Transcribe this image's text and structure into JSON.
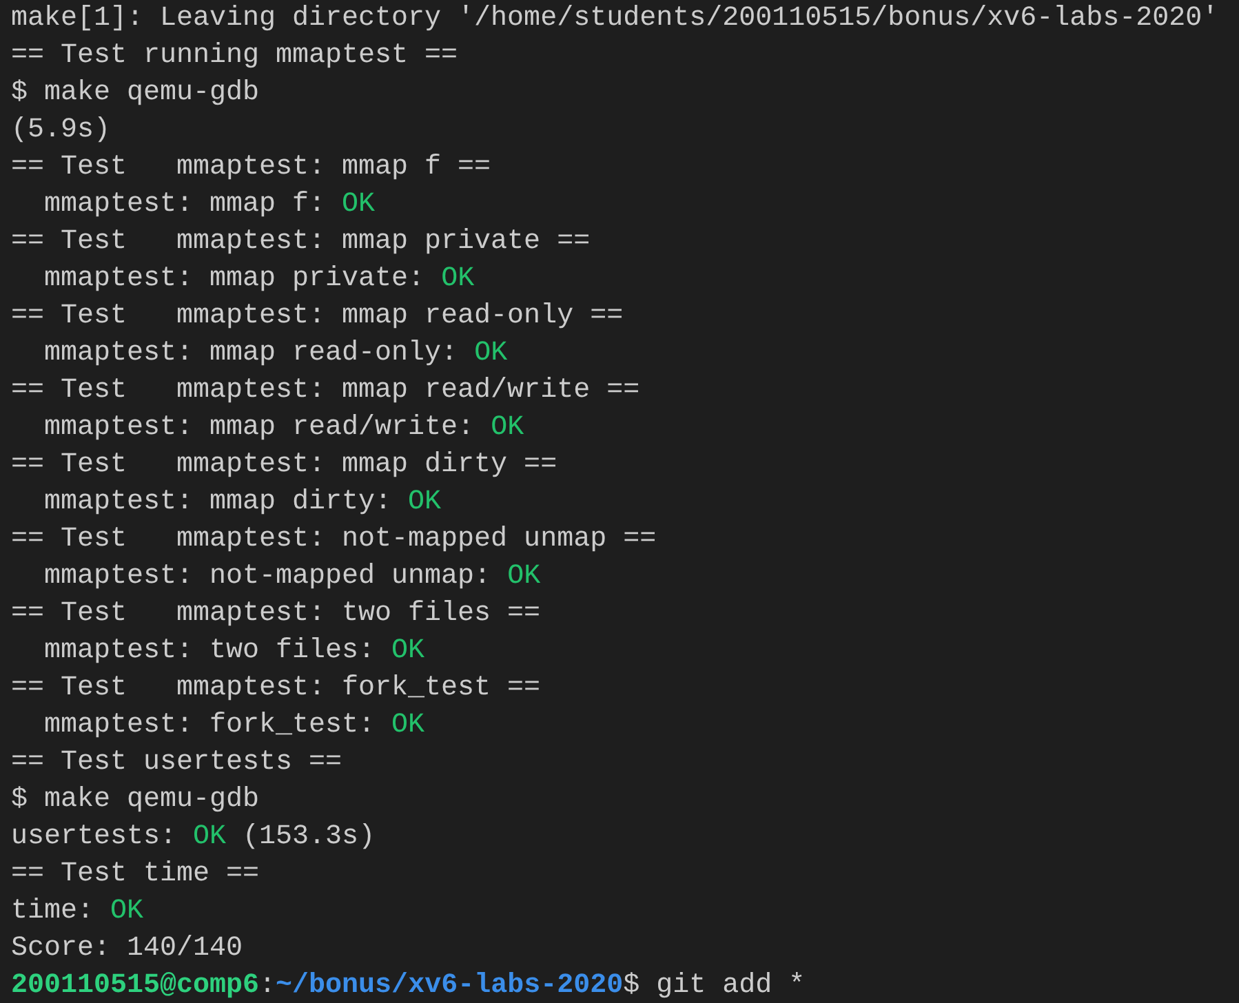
{
  "terminal": {
    "lines": [
      {
        "segments": [
          {
            "kind": "output",
            "text": "make[1]: Leaving directory '/home/students/200110515/bonus/xv6-labs-2020'"
          }
        ]
      },
      {
        "segments": [
          {
            "kind": "output",
            "text": "== Test running mmaptest =="
          }
        ]
      },
      {
        "segments": [
          {
            "kind": "output",
            "text": "$ make qemu-gdb"
          }
        ]
      },
      {
        "segments": [
          {
            "kind": "output",
            "text": "(5.9s)"
          }
        ]
      },
      {
        "segments": [
          {
            "kind": "output",
            "text": "== Test   mmaptest: mmap f =="
          }
        ]
      },
      {
        "segments": [
          {
            "kind": "output",
            "text": "  mmaptest: mmap f: "
          },
          {
            "kind": "ok",
            "text": "OK"
          }
        ]
      },
      {
        "segments": [
          {
            "kind": "output",
            "text": "== Test   mmaptest: mmap private =="
          }
        ]
      },
      {
        "segments": [
          {
            "kind": "output",
            "text": "  mmaptest: mmap private: "
          },
          {
            "kind": "ok",
            "text": "OK"
          }
        ]
      },
      {
        "segments": [
          {
            "kind": "output",
            "text": "== Test   mmaptest: mmap read-only =="
          }
        ]
      },
      {
        "segments": [
          {
            "kind": "output",
            "text": "  mmaptest: mmap read-only: "
          },
          {
            "kind": "ok",
            "text": "OK"
          }
        ]
      },
      {
        "segments": [
          {
            "kind": "output",
            "text": "== Test   mmaptest: mmap read/write =="
          }
        ]
      },
      {
        "segments": [
          {
            "kind": "output",
            "text": "  mmaptest: mmap read/write: "
          },
          {
            "kind": "ok",
            "text": "OK"
          }
        ]
      },
      {
        "segments": [
          {
            "kind": "output",
            "text": "== Test   mmaptest: mmap dirty =="
          }
        ]
      },
      {
        "segments": [
          {
            "kind": "output",
            "text": "  mmaptest: mmap dirty: "
          },
          {
            "kind": "ok",
            "text": "OK"
          }
        ]
      },
      {
        "segments": [
          {
            "kind": "output",
            "text": "== Test   mmaptest: not-mapped unmap =="
          }
        ]
      },
      {
        "segments": [
          {
            "kind": "output",
            "text": "  mmaptest: not-mapped unmap: "
          },
          {
            "kind": "ok",
            "text": "OK"
          }
        ]
      },
      {
        "segments": [
          {
            "kind": "output",
            "text": "== Test   mmaptest: two files =="
          }
        ]
      },
      {
        "segments": [
          {
            "kind": "output",
            "text": "  mmaptest: two files: "
          },
          {
            "kind": "ok",
            "text": "OK"
          }
        ]
      },
      {
        "segments": [
          {
            "kind": "output",
            "text": "== Test   mmaptest: fork_test =="
          }
        ]
      },
      {
        "segments": [
          {
            "kind": "output",
            "text": "  mmaptest: fork_test: "
          },
          {
            "kind": "ok",
            "text": "OK"
          }
        ]
      },
      {
        "segments": [
          {
            "kind": "output",
            "text": "== Test usertests =="
          }
        ]
      },
      {
        "segments": [
          {
            "kind": "output",
            "text": "$ make qemu-gdb"
          }
        ]
      },
      {
        "segments": [
          {
            "kind": "output",
            "text": "usertests: "
          },
          {
            "kind": "ok",
            "text": "OK"
          },
          {
            "kind": "output",
            "text": " (153.3s)"
          }
        ]
      },
      {
        "segments": [
          {
            "kind": "output",
            "text": "== Test time =="
          }
        ]
      },
      {
        "segments": [
          {
            "kind": "output",
            "text": "time: "
          },
          {
            "kind": "ok",
            "text": "OK"
          }
        ]
      },
      {
        "segments": [
          {
            "kind": "output",
            "text": "Score: 140/140"
          }
        ]
      },
      {
        "segments": [
          {
            "kind": "prompt_user",
            "text": "200110515@comp6"
          },
          {
            "kind": "output",
            "text": ":"
          },
          {
            "kind": "prompt_path",
            "text": "~/bonus/xv6-labs-2020"
          },
          {
            "kind": "output",
            "text": "$ git add *"
          }
        ]
      }
    ]
  }
}
